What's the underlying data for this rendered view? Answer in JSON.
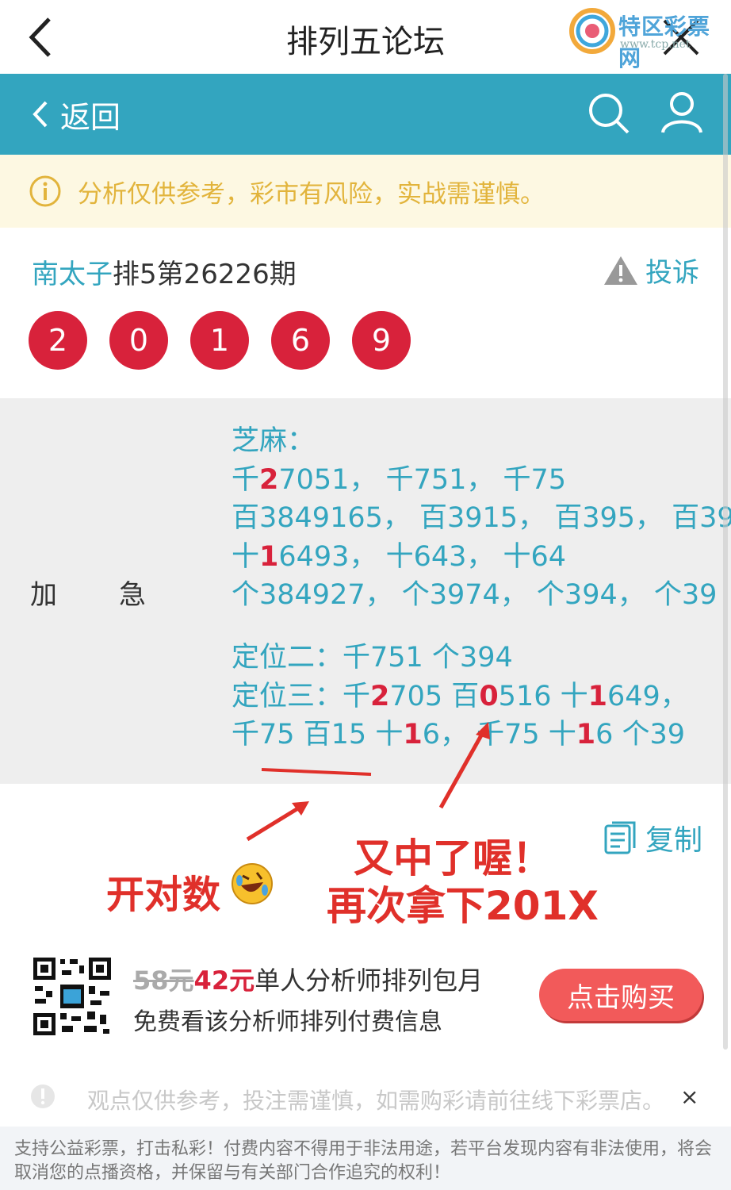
{
  "topbar": {
    "title": "排列五论坛"
  },
  "watermark": {
    "name": "特区彩票网",
    "url": "www.tcp.net"
  },
  "nav": {
    "back_label": "返回"
  },
  "notice": {
    "text": "分析仅供参考，彩市有风险，实战需谨慎。"
  },
  "post": {
    "author": "南太子",
    "title_rest": "排5第26226期",
    "report_label": "投诉",
    "numbers": [
      "2",
      "0",
      "1",
      "6",
      "9"
    ]
  },
  "content": {
    "label_a": "加",
    "label_b": "急",
    "lines": [
      [
        {
          "t": "芝麻："
        }
      ],
      [
        {
          "t": "千"
        },
        {
          "t": "2",
          "red": true
        },
        {
          "t": "7051，  千751，  千75"
        }
      ],
      [
        {
          "t": "百3849165，  百3915，  百395，  百39"
        }
      ],
      [
        {
          "t": "十"
        },
        {
          "t": "1",
          "red": true
        },
        {
          "t": "6493，  十643，  十64"
        }
      ],
      [
        {
          "t": "个384927，  个3974，  个394，  个39"
        }
      ],
      [],
      [
        {
          "t": "定位二：千751 个394"
        }
      ],
      [
        {
          "t": "定位三：千"
        },
        {
          "t": "2",
          "red": true
        },
        {
          "t": "705 百"
        },
        {
          "t": "0",
          "red": true
        },
        {
          "t": "516 十"
        },
        {
          "t": "1",
          "red": true
        },
        {
          "t": "649，"
        }
      ],
      [
        {
          "t": "千75 百15 十"
        },
        {
          "t": "1",
          "red": true
        },
        {
          "t": "6，  千75 十"
        },
        {
          "t": "1",
          "red": true
        },
        {
          "t": "6 个39"
        }
      ]
    ]
  },
  "copy": {
    "label": "复制"
  },
  "annotations": {
    "left": "开对数",
    "right_line1": "又中了喔！",
    "right_line2": "再次拿下201X"
  },
  "promo": {
    "old_price": "58元",
    "new_price": "42元",
    "title": "单人分析师排列包月",
    "subtitle": "免费看该分析师排列付费信息",
    "buy_label": "点击购买"
  },
  "bottom_tip": {
    "text": "观点仅供参考，投注需谨慎，如需购彩请前往线下彩票店。",
    "close": "×"
  },
  "footer": {
    "text": "支持公益彩票，打击私彩！付费内容不得用于非法用途，若平台发现内容有非法使用，将会取消您的点播资格，并保留与有关部门合作追究的权利！"
  },
  "colors": {
    "teal": "#33a5bf",
    "red": "#d8223b",
    "notice_bg": "#fdf8e2",
    "notice_text": "#e2b43c"
  }
}
